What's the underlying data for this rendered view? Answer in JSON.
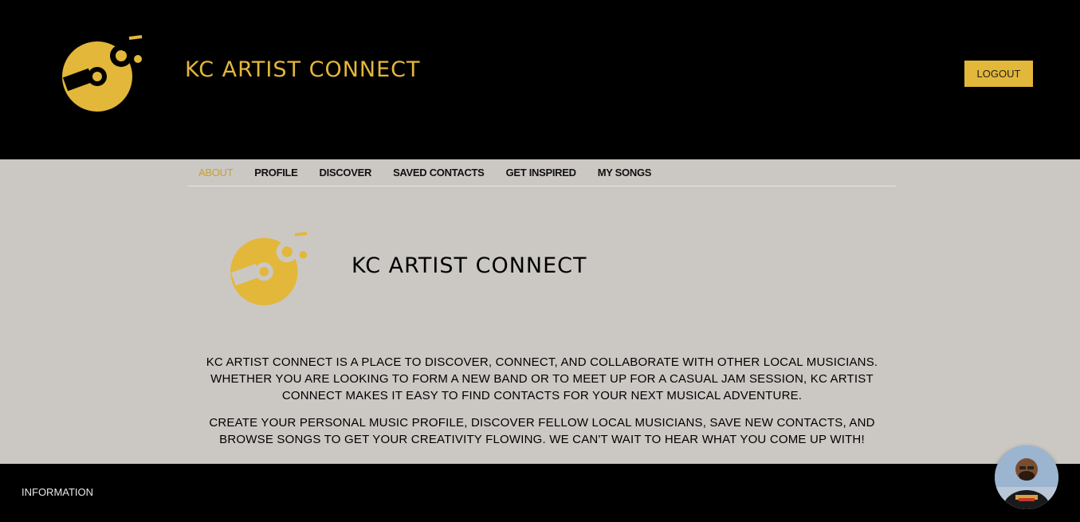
{
  "header": {
    "title": "KC ARTIST CONNECT",
    "logout_label": "LOGOUT",
    "accent_color": "#e3b73a"
  },
  "nav": {
    "items": [
      {
        "label": "ABOUT",
        "active": true
      },
      {
        "label": "PROFILE",
        "active": false
      },
      {
        "label": "DISCOVER",
        "active": false
      },
      {
        "label": "SAVED CONTACTS",
        "active": false
      },
      {
        "label": "GET INSPIRED",
        "active": false
      },
      {
        "label": "MY SONGS",
        "active": false
      }
    ]
  },
  "about": {
    "title": "KC ARTIST CONNECT",
    "paragraph1": "KC ARTIST CONNECT IS A PLACE TO DISCOVER, CONNECT, AND COLLABORATE WITH OTHER LOCAL MUSICIANS. WHETHER YOU ARE LOOKING TO FORM A NEW BAND OR TO MEET UP FOR A CASUAL JAM SESSION, KC ARTIST CONNECT MAKES IT EASY TO FIND CONTACTS FOR YOUR NEXT MUSICAL ADVENTURE.",
    "paragraph2": "CREATE YOUR PERSONAL MUSIC PROFILE, DISCOVER FELLOW LOCAL MUSICIANS, SAVE NEW CONTACTS, AND BROWSE SONGS TO GET YOUR CREATIVITY FLOWING. WE CAN'T WAIT TO HEAR WHAT YOU COME UP WITH!"
  },
  "footer": {
    "info_label": "INFORMATION"
  },
  "icons": {
    "logo": "vinyl-music-note-icon",
    "avatar": "user-avatar"
  }
}
